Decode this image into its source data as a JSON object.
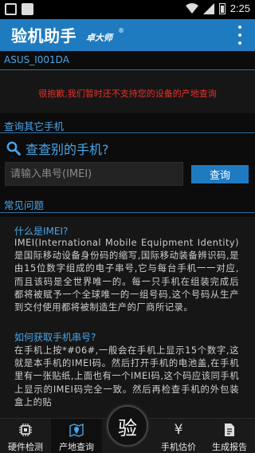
{
  "status_bar": {
    "time": "2:25",
    "icons": [
      "notification-icon",
      "clipboard-icon",
      "wifi-icon",
      "signal-icon",
      "battery-icon"
    ]
  },
  "app_bar": {
    "title": "验机助手",
    "brand": "卓大师",
    "registered_mark": "®",
    "menu_icon": "overflow-menu-icon"
  },
  "device": {
    "name": "ASUS_I001DA",
    "notice": "很抱歉,我们暂时还不支持您的设备的产地查询"
  },
  "query_section": {
    "title": "查询其它手机",
    "heading": "查查别的手机?",
    "input_placeholder": "请输入串号(IMEI)",
    "input_value": "",
    "button_label": "查询"
  },
  "faq": {
    "title": "常见问题",
    "items": [
      {
        "question": "什么是IMEI?",
        "answer": "IMEI(International Mobile Equipment Identity)是国际移动设备身份码的缩写,国际移动装备辨识码,是由15位数字组成的电子串号,它与每台手机一一对应,而且该码是全世界唯一的。每一只手机在组装完成后都将被赋予一个全球唯一的一组号码,这个号码从生产到交付使用都将被制造生产的厂商所记录。"
      },
      {
        "question": "如何获取手机串号?",
        "answer": "在手机上按*#06#,一般会在手机上显示15个数字,这就是本手机的IMEI码。然后打开手机的电池盖,在手机里有一张贴纸,上面也有一个IMEI码,这个码应该同手机上显示的IMEI码完全一致。然后再检查手机的外包装盒上的贴"
      }
    ]
  },
  "tabs": [
    {
      "label": "硬件检测",
      "icon": "chip-icon",
      "active": false
    },
    {
      "label": "产地查询",
      "icon": "map-location-icon",
      "active": true
    },
    {
      "label": "验",
      "icon": "verify-icon",
      "active": false
    },
    {
      "label": "手机估价",
      "icon": "yuan-icon",
      "active": false
    },
    {
      "label": "生成报告",
      "icon": "report-icon",
      "active": false
    }
  ],
  "colors": {
    "accent": "#1f7bc0",
    "link": "#4aa6e8",
    "warning": "#e8322b",
    "background": "#0c0c0c"
  }
}
